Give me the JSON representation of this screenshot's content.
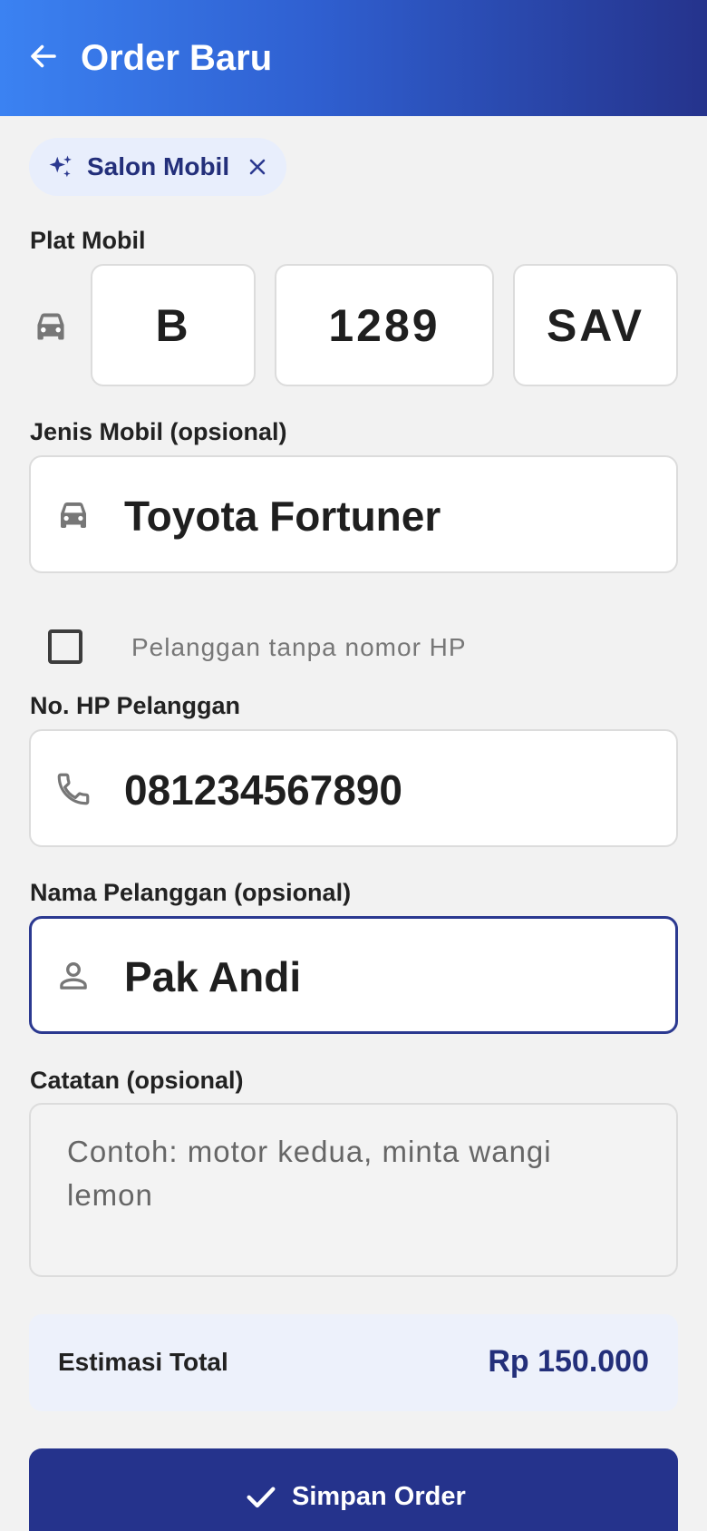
{
  "appbar": {
    "title": "Order Baru",
    "back_icon": "arrow-left-icon",
    "gradient": [
      "#3b82f2",
      "#25338c"
    ]
  },
  "service_chip": {
    "label": "Salon Mobil",
    "icon": "sparkle-icon",
    "remove_icon": "close-icon"
  },
  "plate": {
    "label": "Plat Mobil",
    "icon": "car-icon",
    "region": "B",
    "number": "1289",
    "suffix": "SAV"
  },
  "car_type": {
    "label": "Jenis Mobil (opsional)",
    "icon": "car-icon",
    "value": "Toyota Fortuner"
  },
  "no_phone": {
    "label": "Pelanggan tanpa nomor HP",
    "checked": false
  },
  "phone": {
    "label": "No. HP Pelanggan",
    "icon": "phone-icon",
    "value": "081234567890"
  },
  "customer_name": {
    "label": "Nama Pelanggan (opsional)",
    "icon": "person-icon",
    "value": "Pak Andi"
  },
  "notes": {
    "label": "Catatan (opsional)",
    "placeholder": "Contoh: motor kedua, minta wangi lemon"
  },
  "total": {
    "label": "Estimasi Total",
    "value": "Rp 150.000"
  },
  "submit": {
    "label": "Simpan Order",
    "icon": "check-icon"
  },
  "colors": {
    "primary": "#25338c",
    "accent": "#3b82f2",
    "background": "#f2f2f2",
    "chip_bg": "#e8eefc"
  }
}
